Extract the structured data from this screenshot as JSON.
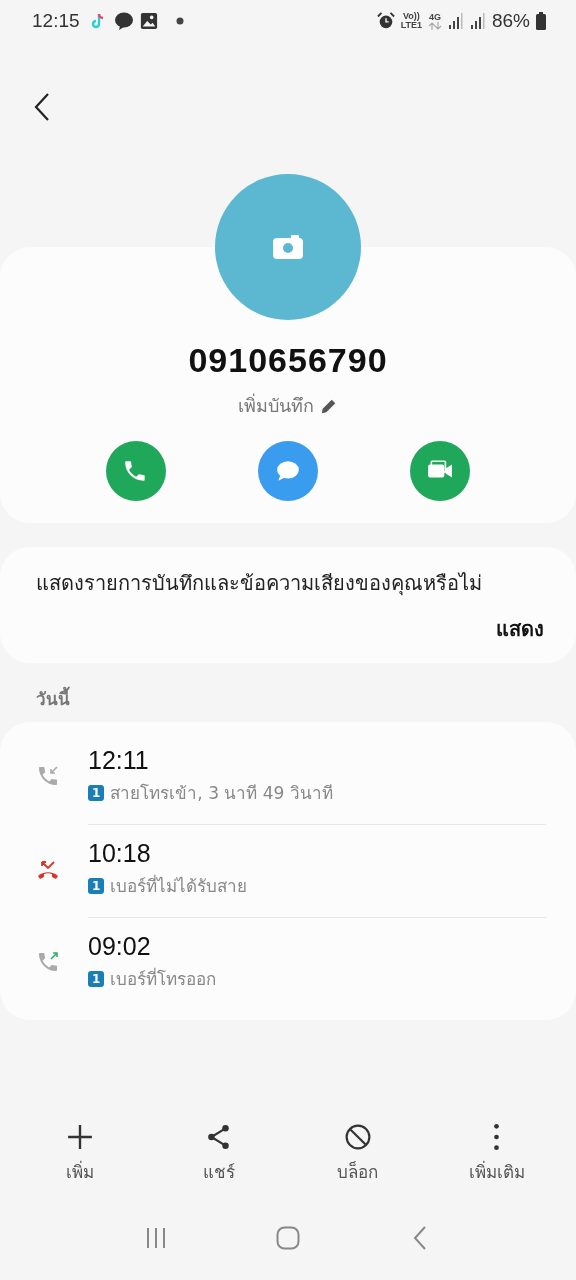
{
  "status_bar": {
    "time": "12:15",
    "volte": "Vo))",
    "volte_sub": "LTE1",
    "network": "4G",
    "battery": "86%"
  },
  "contact": {
    "number": "0910656790",
    "note_label": "เพิ่มบันทึก"
  },
  "actions": [
    {
      "kind": "call"
    },
    {
      "kind": "message"
    },
    {
      "kind": "video"
    }
  ],
  "recording_prompt": {
    "text": "แสดงรายการบันทึกและข้อความเสียงของคุณหรือไม่",
    "button": "แสดง"
  },
  "section_title": "วันนี้",
  "calls": [
    {
      "kind": "incoming",
      "time": "12:11",
      "sim": "1",
      "detail": "สายโทรเข้า, 3 นาที 49 วินาที"
    },
    {
      "kind": "missed",
      "time": "10:18",
      "sim": "1",
      "detail": "เบอร์ที่ไม่ได้รับสาย"
    },
    {
      "kind": "outgoing",
      "time": "09:02",
      "sim": "1",
      "detail": "เบอร์ที่โทรออก"
    }
  ],
  "bottom_bar": [
    {
      "kind": "add",
      "label": "เพิ่ม"
    },
    {
      "kind": "share",
      "label": "แชร์"
    },
    {
      "kind": "block",
      "label": "บล็อก"
    },
    {
      "kind": "more",
      "label": "เพิ่มเติม"
    }
  ]
}
